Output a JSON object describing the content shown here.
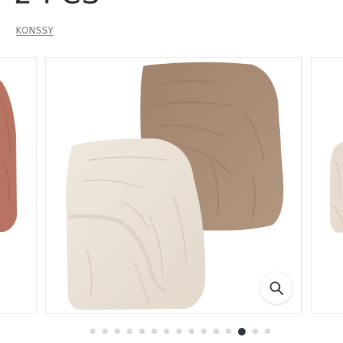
{
  "product": {
    "title": "2 PCS",
    "vendor": "KONSSY"
  },
  "gallery": {
    "slide_count": 15,
    "active_index": 12,
    "zoom_icon": "magnifier-icon",
    "colors": {
      "prev_sheet": "#b87462",
      "back_sheet": "#a68a74",
      "front_sheet": "#ebe3d7",
      "active_dot": "#2f3640",
      "inactive_dot": "#d8d8d8"
    }
  }
}
